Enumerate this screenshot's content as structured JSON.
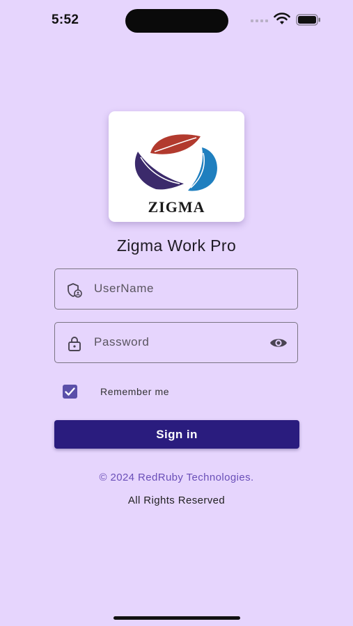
{
  "status_bar": {
    "time": "5:52",
    "icons": [
      "cellular-signal-icon",
      "wifi-icon",
      "battery-icon"
    ]
  },
  "logo": {
    "text": "ZIGMA",
    "colors": {
      "red_leaf": "#b23a2e",
      "purple_leaf": "#3b2a6b",
      "blue_leaf": "#1f7fbf"
    }
  },
  "app": {
    "title": "Zigma Work Pro"
  },
  "login_form": {
    "username": {
      "placeholder": "UserName",
      "value": "",
      "icon": "user-shield-icon"
    },
    "password": {
      "placeholder": "Password",
      "value": "",
      "icon": "lock-icon",
      "toggle_icon": "eye-icon"
    },
    "remember_me": {
      "label": "Remember me",
      "checked": true
    },
    "submit_label": "Sign in"
  },
  "footer": {
    "copyright": "© 2024 RedRuby Technologies.",
    "rights": "All Rights Reserved"
  },
  "colors": {
    "background": "#e6d5fd",
    "primary_button": "#2a1c7e",
    "checkbox": "#5b4fa9",
    "link_text": "#6a4fb8"
  }
}
